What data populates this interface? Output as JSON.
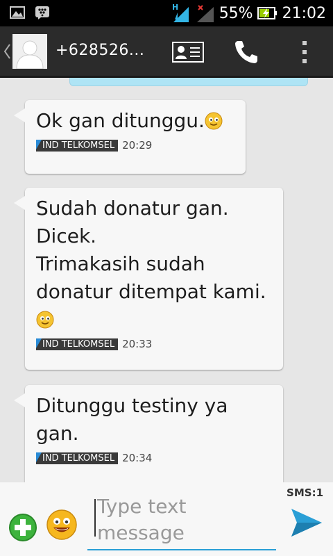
{
  "status_bar": {
    "battery_percent": "55%",
    "time": "21:02",
    "network_type": "H",
    "icons": [
      "image-icon",
      "bbm-icon",
      "signal-h-icon",
      "signal-no-data-icon",
      "battery-charging-icon"
    ]
  },
  "header": {
    "contact_number": "+628526...",
    "icons": [
      "back-chevron-icon",
      "contact-avatar",
      "contact-card-icon",
      "phone-call-icon",
      "overflow-menu-icon"
    ]
  },
  "messages": [
    {
      "text": "Ok gan ditunggu.",
      "emoticon": true,
      "sim_label": "IND TELKOMSEL",
      "time": "20:29"
    },
    {
      "text": "Sudah donatur gan.\nDicek.\nTrimakasih sudah donatur ditempat kami.",
      "emoticon": true,
      "sim_label": "IND TELKOMSEL",
      "time": "20:33"
    },
    {
      "text": "Ditunggu testiny ya gan.",
      "emoticon": false,
      "sim_label": "IND TELKOMSEL",
      "time": "20:34"
    }
  ],
  "compose": {
    "sms_counter": "SMS:1",
    "placeholder": "Type text message",
    "icons": [
      "add-attachment-icon",
      "emoji-icon",
      "send-icon"
    ]
  },
  "colors": {
    "accent_blue": "#2a9fd6",
    "action_bar": "#2b2b2b",
    "bubble": "#f7f7f7",
    "background": "#e6e6e6"
  }
}
